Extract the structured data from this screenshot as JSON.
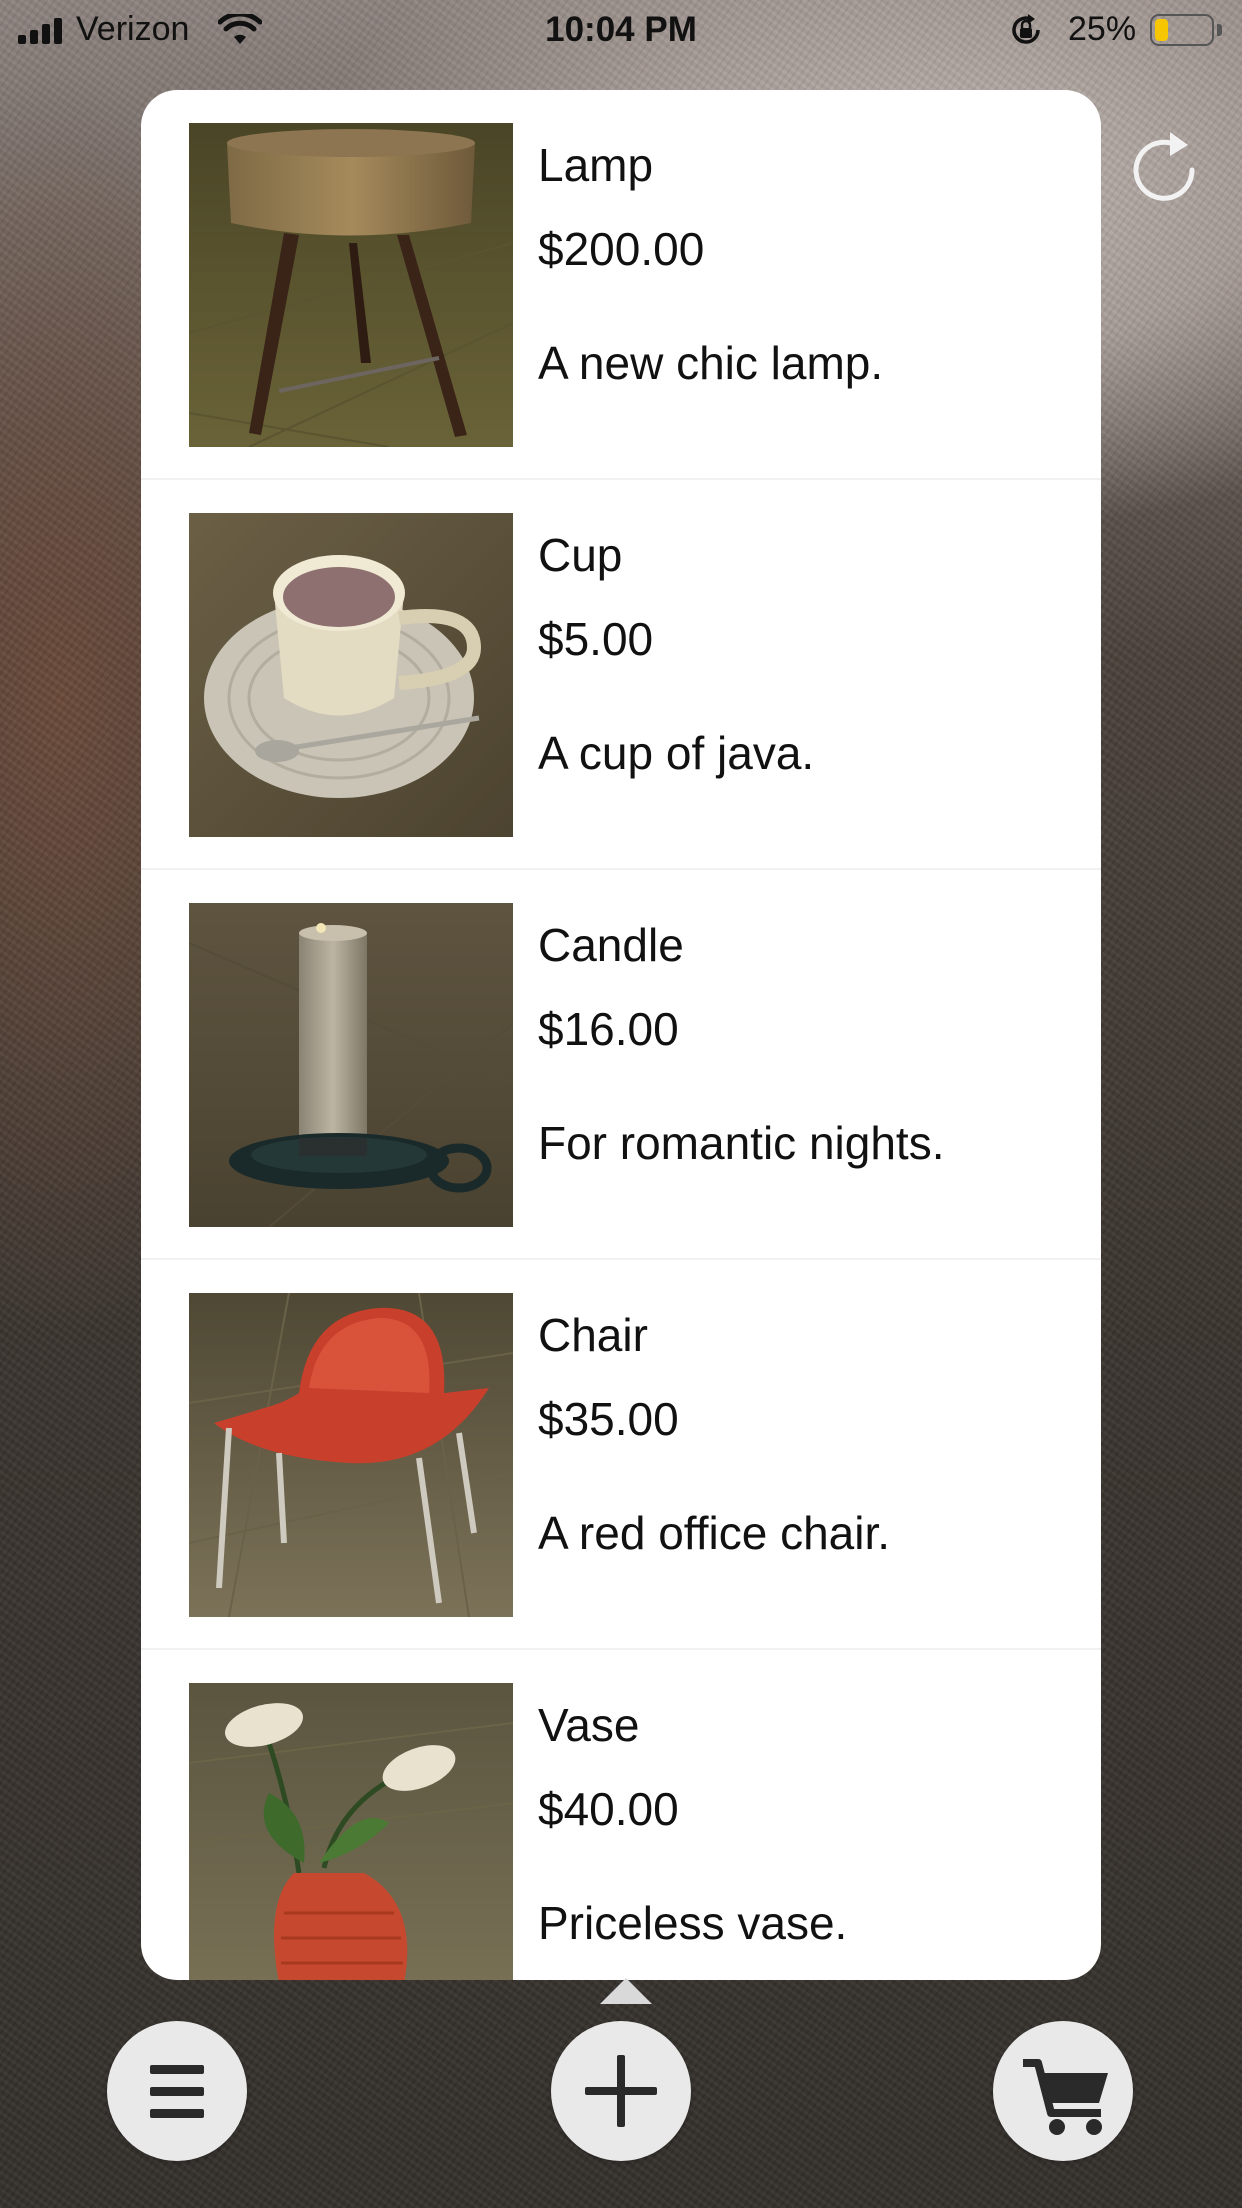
{
  "status_bar": {
    "carrier": "Verizon",
    "time": "10:04 PM",
    "battery_percent": "25%",
    "battery_level": 0.25
  },
  "products": [
    {
      "name": "Lamp",
      "price": "$200.00",
      "description": "A new chic lamp."
    },
    {
      "name": "Cup",
      "price": "$5.00",
      "description": "A cup of java."
    },
    {
      "name": "Candle",
      "price": "$16.00",
      "description": "For romantic nights."
    },
    {
      "name": "Chair",
      "price": "$35.00",
      "description": "A red office chair."
    },
    {
      "name": "Vase",
      "price": "$40.00",
      "description": "Priceless vase."
    }
  ],
  "icons": {
    "refresh": "refresh-icon",
    "menu": "hamburger-menu-icon",
    "add": "plus-icon",
    "cart": "shopping-cart-icon"
  },
  "colors": {
    "panel": "#ffffff",
    "button": "#e9e9e9",
    "icon": "#2a2a2a",
    "battery": "#f6c700"
  }
}
